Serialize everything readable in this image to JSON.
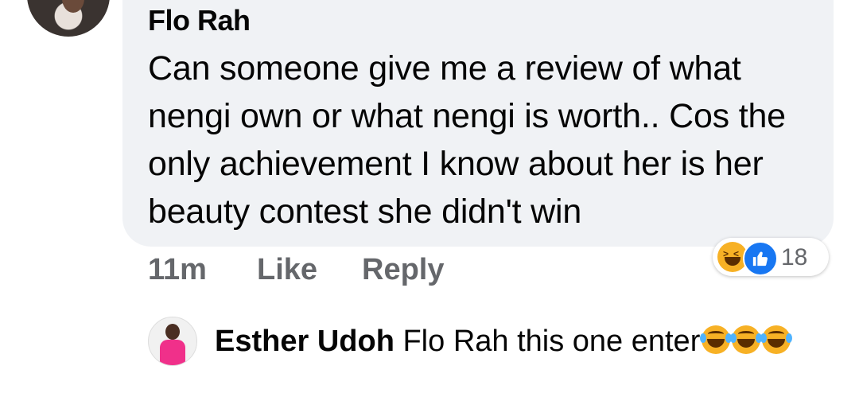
{
  "comment": {
    "author": "Flo Rah",
    "text": "Can someone give me a review of what nengi own or what nengi is worth.. Cos the only achievement I know about her is her beauty contest she didn't win",
    "time": "11m",
    "like_label": "Like",
    "reply_label": "Reply",
    "reactions": {
      "icons": [
        "haha-icon",
        "like-icon"
      ],
      "count": "18"
    }
  },
  "reply": {
    "author": "Esther Udoh",
    "text": "Flo Rah this one enter",
    "emojis": [
      "laughing-tears-emoji",
      "laughing-tears-emoji",
      "laughing-tears-emoji"
    ]
  },
  "colors": {
    "bubble": "#f0f2f5",
    "meta_text": "#65676b",
    "like_blue": "#1877f2",
    "haha_yellow": "#f7b125"
  }
}
